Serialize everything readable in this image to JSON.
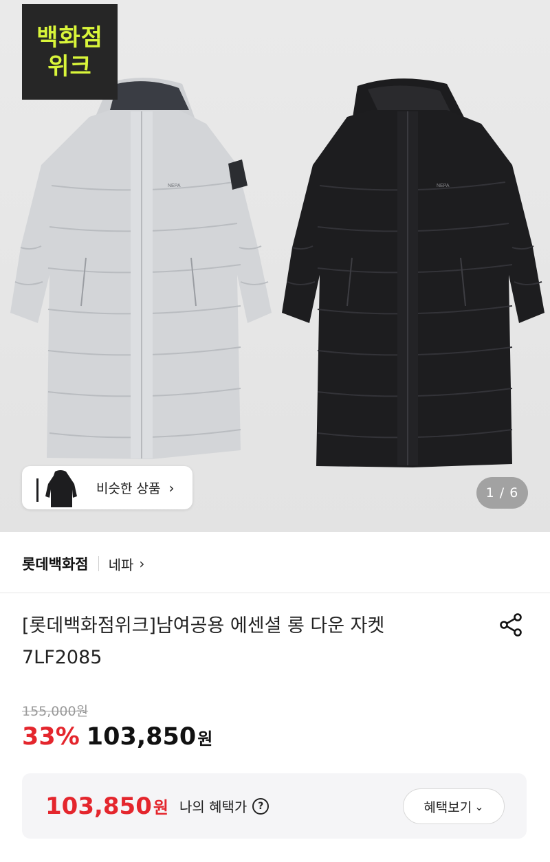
{
  "hero": {
    "event_badge": {
      "line1": "백화점",
      "line2": "위크",
      "bg": "#262626",
      "fg": "#d9f53a"
    },
    "coats": [
      "light-gray-long-down-jacket",
      "black-long-down-jacket"
    ],
    "logo_text": "NEPA",
    "similar_label": "비슷한 상품",
    "similar_chevron": "›",
    "page_counter": "1 / 6"
  },
  "brand": {
    "store": "롯데백화점",
    "brand": "네파",
    "chevron": "›"
  },
  "product": {
    "title": "[롯데백화점위크]남여공용 에센셜 롱 다운 자켓 7LF2085"
  },
  "pricing": {
    "original_price": "155,000원",
    "discount": "33%",
    "price": "103,850",
    "currency": "원",
    "accent_color": "#e4262d"
  },
  "benefit": {
    "price": "103,850",
    "currency": "원",
    "label": "나의 혜택가",
    "help": "?",
    "button_label": "혜택보기",
    "button_chevron": "⌄"
  }
}
